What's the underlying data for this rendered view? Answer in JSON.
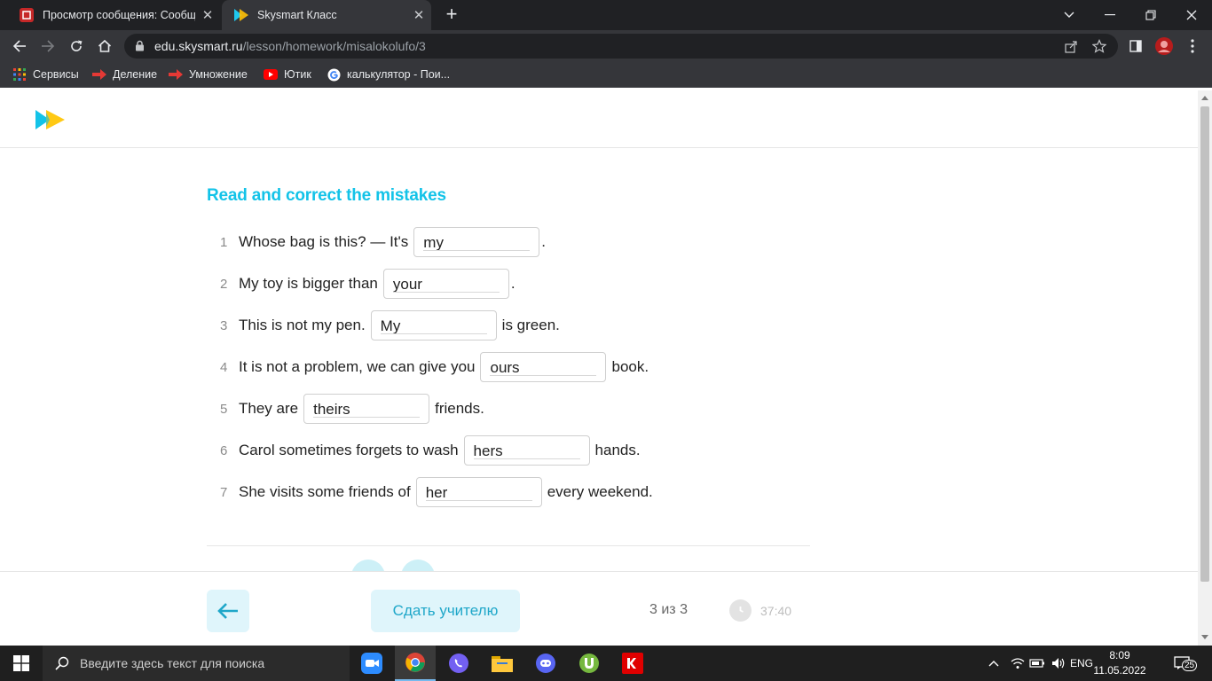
{
  "browser": {
    "tabs": [
      {
        "title": "Просмотр сообщения: Сообщения",
        "active": false
      },
      {
        "title": "Skysmart Класс",
        "active": true
      }
    ],
    "url_host": "edu.skysmart.ru",
    "url_path": "/lesson/homework/misalokolufo/3",
    "bookmarks": [
      {
        "label": "Сервисы",
        "icon": "apps-grid-icon"
      },
      {
        "label": "Деление",
        "icon": "red-arrow-icon"
      },
      {
        "label": "Умножение",
        "icon": "red-arrow-icon"
      },
      {
        "label": "Ютик",
        "icon": "youtube-icon"
      },
      {
        "label": "калькулятор - Пои...",
        "icon": "google-icon"
      }
    ]
  },
  "exercise": {
    "title": "Read and correct the mistakes",
    "items": [
      {
        "num": "1",
        "before": "Whose bag is this? — It's",
        "answer": "my",
        "after": "."
      },
      {
        "num": "2",
        "before": "My toy is bigger than",
        "answer": "your",
        "after": "."
      },
      {
        "num": "3",
        "before": "This is not my pen.",
        "answer": "My",
        "after": "is green."
      },
      {
        "num": "4",
        "before": "It is not a problem, we can give you",
        "answer": "ours",
        "after": "book."
      },
      {
        "num": "5",
        "before": "They are",
        "answer": "theirs",
        "after": "friends."
      },
      {
        "num": "6",
        "before": "Carol sometimes forgets to wash",
        "answer": "hers",
        "after": "hands."
      },
      {
        "num": "7",
        "before": "She visits some friends of",
        "answer": "her",
        "after": "every weekend."
      }
    ]
  },
  "footer": {
    "submit_label": "Сдать учителю",
    "progress": "3 из 3",
    "timer": "37:40"
  },
  "taskbar": {
    "search_placeholder": "Введите здесь текст для поиска",
    "lang": "ENG",
    "time": "8:09",
    "date": "11.05.2022",
    "notifications": "25"
  },
  "colors": {
    "accent": "#13c3e8",
    "button_bg": "#dff5fb",
    "chrome_dark": "#202124",
    "chrome_mid": "#35363a"
  }
}
